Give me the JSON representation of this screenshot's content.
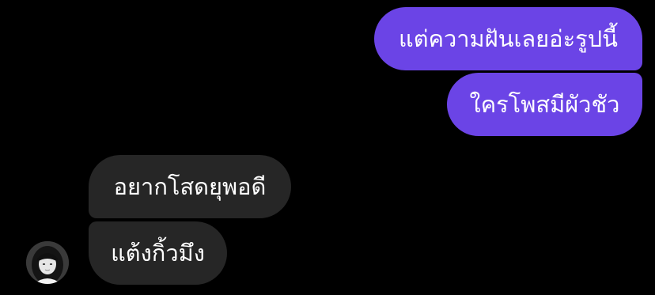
{
  "messages": [
    {
      "id": "msg1",
      "direction": "sent",
      "text": "แต่ความฝันเลยอ่ะรูปนี้"
    },
    {
      "id": "msg2",
      "direction": "sent",
      "text": "ใครโพสมีผัวชัว"
    },
    {
      "id": "msg3",
      "direction": "received",
      "text": "อยากโสดยุพอดี"
    },
    {
      "id": "msg4",
      "direction": "received",
      "text": "แต้งกิ้วมึง"
    }
  ],
  "colors": {
    "background": "#000000",
    "sent_bubble": "#6b44e6",
    "received_bubble": "#262626",
    "text": "#ffffff"
  },
  "avatar": {
    "icon": "contact-avatar-photo"
  }
}
